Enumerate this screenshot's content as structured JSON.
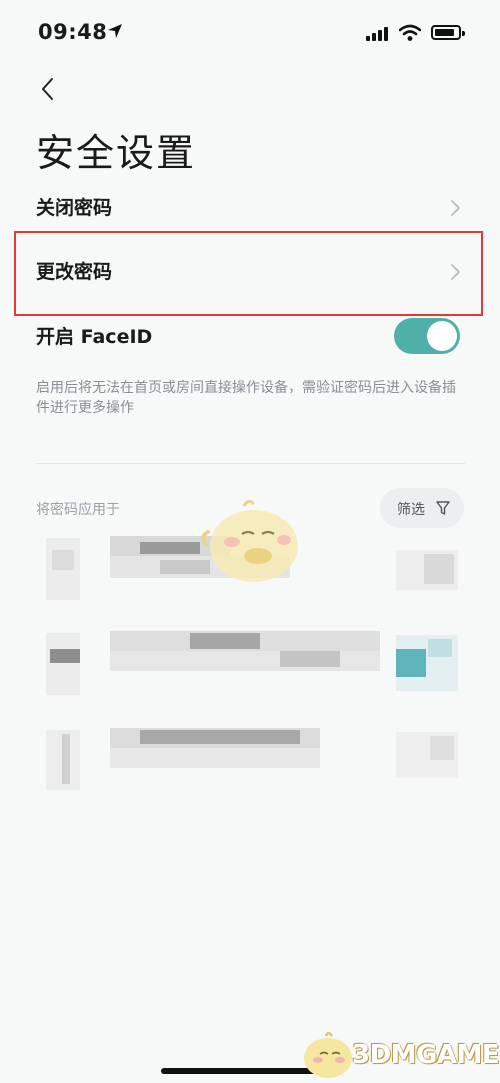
{
  "status_bar": {
    "time": "09:48"
  },
  "page": {
    "title": "安全设置"
  },
  "settings": {
    "close_password": "关闭密码",
    "change_password": "更改密码",
    "faceid_label": "开启 FaceID",
    "faceid_enabled": true,
    "faceid_description": "启用后将无法在首页或房间直接操作设备，需验证密码后进入设备插件进行更多操作"
  },
  "apply_section": {
    "label": "将密码应用于",
    "filter_label": "筛选"
  },
  "watermark": {
    "text": "3DMGAME"
  },
  "colors": {
    "toggle_on": "#4fb0a9",
    "highlight_border": "#e03a3a",
    "accent": "#4fb0a9"
  }
}
